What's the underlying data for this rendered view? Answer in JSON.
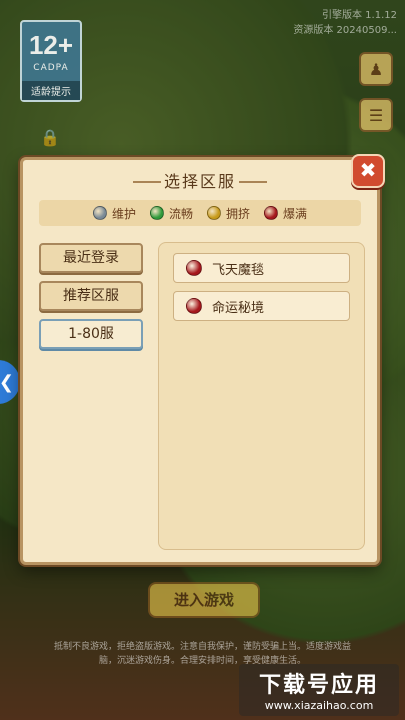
{
  "age_badge": {
    "rating": "12+",
    "org": "CADPA",
    "tip": "适龄提示"
  },
  "version": {
    "line1": "引擎版本 1.1.12",
    "line2": "资源版本 20240509..."
  },
  "lock_label": "",
  "dialog": {
    "title": "选择区服",
    "close_label": "✖",
    "legend": [
      {
        "label": "维护",
        "color": "#7a8a96"
      },
      {
        "label": "流畅",
        "color": "#2f9a3a"
      },
      {
        "label": "拥挤",
        "color": "#c79a1a"
      },
      {
        "label": "爆满",
        "color": "#a5171c"
      }
    ],
    "tabs": [
      {
        "label": "最近登录"
      },
      {
        "label": "推荐区服"
      },
      {
        "label": "1-80服"
      }
    ],
    "servers": [
      {
        "name": "飞天魔毯",
        "status_color": "#a5171c"
      },
      {
        "name": "命运秘境",
        "status_color": "#a5171c"
      }
    ]
  },
  "enter_button": "进入游戏",
  "notice": "抵制不良游戏，拒绝盗版游戏。注意自我保护，谨防受骗上当。适度游戏益脑，沉迷游戏伤身。合理安排时间，享受健康生活。",
  "watermark": {
    "big": "下载号应用",
    "small": "www.xiazaihao.com"
  }
}
